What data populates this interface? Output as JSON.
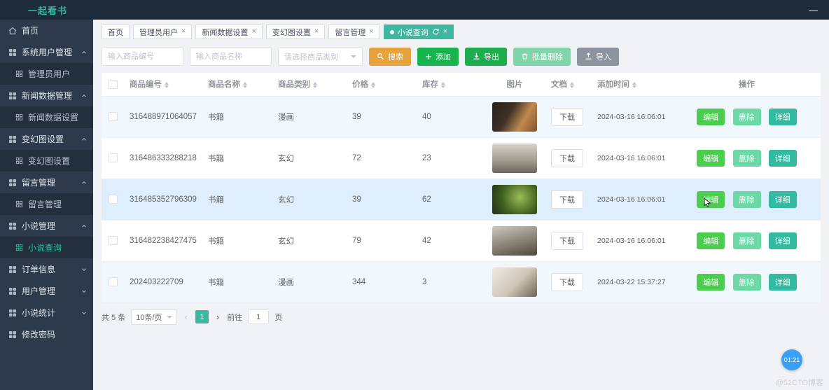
{
  "app": {
    "title": "一起看书"
  },
  "icons": {
    "minimize": "—",
    "close": "×",
    "prev": "‹",
    "next": "›"
  },
  "tabs": [
    {
      "label": "首页"
    },
    {
      "label": "管理员用户"
    },
    {
      "label": "新闻数据设置"
    },
    {
      "label": "变幻图设置"
    },
    {
      "label": "留言管理"
    },
    {
      "label": "小说查询"
    }
  ],
  "sidebar": {
    "items": [
      {
        "label": "首页"
      },
      {
        "label": "系统用户管理"
      },
      {
        "label": "管理员用户"
      },
      {
        "label": "新闻数据管理"
      },
      {
        "label": "新闻数据设置"
      },
      {
        "label": "变幻图设置"
      },
      {
        "label": "变幻图设置"
      },
      {
        "label": "留言管理"
      },
      {
        "label": "留言管理"
      },
      {
        "label": "小说管理"
      },
      {
        "label": "小说查询"
      },
      {
        "label": "订单信息"
      },
      {
        "label": "用户管理"
      },
      {
        "label": "小说统计"
      },
      {
        "label": "修改密码"
      }
    ]
  },
  "filters": {
    "sn_placeholder": "输入商品编号",
    "name_placeholder": "输入商品名称",
    "category_placeholder": "请选择商品类别",
    "search_label": "搜索",
    "add_label": "添加",
    "export_label": "导出",
    "batch_delete_label": "批量删除",
    "import_label": "导入"
  },
  "table": {
    "headers": [
      "商品编号",
      "商品名称",
      "商品类别",
      "价格",
      "库存",
      "图片",
      "文档",
      "添加时间",
      "操作"
    ],
    "actions": {
      "edit": "编辑",
      "delete": "删除",
      "detail": "详细"
    },
    "rows": [
      {
        "sn": "316488971064057",
        "name": "书籍",
        "category": "漫画",
        "price": "39",
        "stock": "40",
        "doc": "下载",
        "time": "2024-03-16 16:06:01"
      },
      {
        "sn": "316486333288218",
        "name": "书籍",
        "category": "玄幻",
        "price": "72",
        "stock": "23",
        "doc": "下载",
        "time": "2024-03-16 16:06:01"
      },
      {
        "sn": "316485352796309",
        "name": "书籍",
        "category": "玄幻",
        "price": "39",
        "stock": "62",
        "doc": "下载",
        "time": "2024-03-16 16:06:01"
      },
      {
        "sn": "316482238427475",
        "name": "书籍",
        "category": "玄幻",
        "price": "79",
        "stock": "42",
        "doc": "下载",
        "time": "2024-03-16 16:06:01"
      },
      {
        "sn": "202403222709",
        "name": "书籍",
        "category": "漫画",
        "price": "344",
        "stock": "3",
        "doc": "下载",
        "time": "2024-03-22 15:37:27"
      }
    ]
  },
  "pagination": {
    "total": "共 5 条",
    "page_size": "10条/页",
    "current_page": "1",
    "goto_label": "前往",
    "goto_value": "1",
    "goto_unit": "页"
  },
  "widgets": {
    "timer": "01:21",
    "watermark": "@51CTO博客"
  }
}
